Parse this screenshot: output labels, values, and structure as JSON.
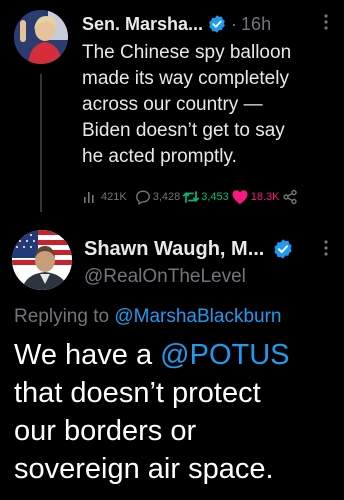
{
  "parent_tweet": {
    "author_name": "Sen. Marsha...",
    "separator": "·",
    "time": "16h",
    "text_lines": [
      "The Chinese spy balloon",
      "made its way completely",
      "across our country —",
      "Biden doesn’t get to say",
      "he acted promptly."
    ],
    "stats": {
      "views": "421K",
      "replies": "3,428",
      "retweets": "3,453",
      "likes": "18.3K"
    }
  },
  "reply_tweet": {
    "author_name": "Shawn Waugh, M...",
    "handle": "@RealOnTheLevel",
    "replying_prefix": "Replying to",
    "replying_to": "@MarshaBlackburn",
    "text_line1_prefix": "We have a",
    "mention": "@POTUS",
    "text_lines": [
      "that doesn’t protect",
      "our borders or",
      "sovereign air space."
    ]
  },
  "colors": {
    "background": "#000000",
    "text": "#e7e9ea",
    "secondary": "#71767b",
    "link": "#1d9bf0",
    "verified": "#1d9bf0",
    "retweet": "#00ba7c",
    "like": "#f91880"
  },
  "icons": [
    "verified-badge-icon",
    "more-options-icon",
    "views-icon",
    "reply-icon",
    "retweet-icon",
    "like-icon",
    "share-icon"
  ]
}
